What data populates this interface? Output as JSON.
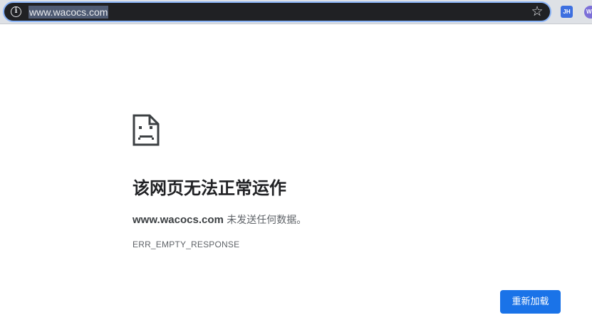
{
  "browser": {
    "url": "www.wacocs.com",
    "extensions": [
      {
        "label": "JH",
        "color": "#3d6fe0"
      },
      {
        "label": "W",
        "color": "#7c6fd8"
      }
    ]
  },
  "error_page": {
    "icon": "sad-page-icon",
    "title": "该网页无法正常运作",
    "host": "www.wacocs.com",
    "message_suffix": " 未发送任何数据。",
    "error_code": "ERR_EMPTY_RESPONSE",
    "reload_label": "重新加载",
    "accent_color": "#1a73e8"
  }
}
